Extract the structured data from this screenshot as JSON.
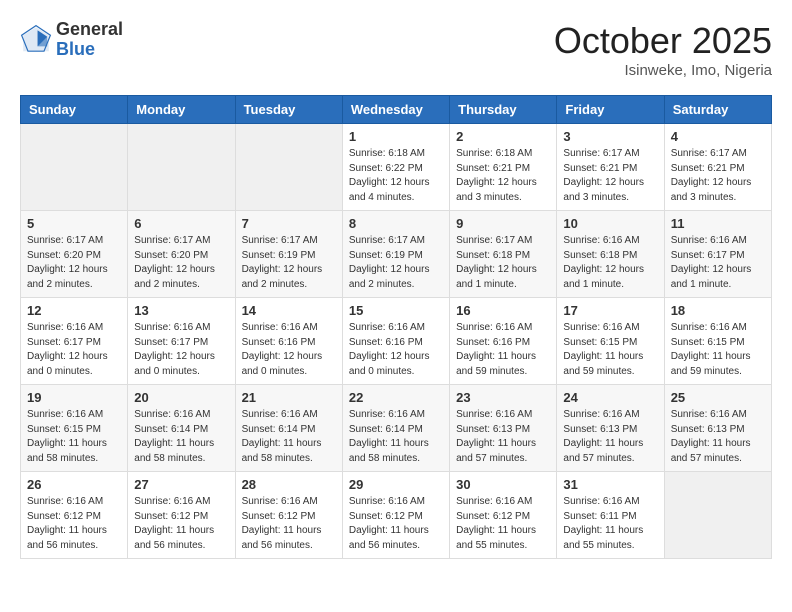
{
  "logo": {
    "general": "General",
    "blue": "Blue"
  },
  "header": {
    "month": "October 2025",
    "location": "Isinweke, Imo, Nigeria"
  },
  "weekdays": [
    "Sunday",
    "Monday",
    "Tuesday",
    "Wednesday",
    "Thursday",
    "Friday",
    "Saturday"
  ],
  "weeks": [
    [
      {
        "day": "",
        "sunrise": "",
        "sunset": "",
        "daylight": ""
      },
      {
        "day": "",
        "sunrise": "",
        "sunset": "",
        "daylight": ""
      },
      {
        "day": "",
        "sunrise": "",
        "sunset": "",
        "daylight": ""
      },
      {
        "day": "1",
        "sunrise": "Sunrise: 6:18 AM",
        "sunset": "Sunset: 6:22 PM",
        "daylight": "Daylight: 12 hours and 4 minutes."
      },
      {
        "day": "2",
        "sunrise": "Sunrise: 6:18 AM",
        "sunset": "Sunset: 6:21 PM",
        "daylight": "Daylight: 12 hours and 3 minutes."
      },
      {
        "day": "3",
        "sunrise": "Sunrise: 6:17 AM",
        "sunset": "Sunset: 6:21 PM",
        "daylight": "Daylight: 12 hours and 3 minutes."
      },
      {
        "day": "4",
        "sunrise": "Sunrise: 6:17 AM",
        "sunset": "Sunset: 6:21 PM",
        "daylight": "Daylight: 12 hours and 3 minutes."
      }
    ],
    [
      {
        "day": "5",
        "sunrise": "Sunrise: 6:17 AM",
        "sunset": "Sunset: 6:20 PM",
        "daylight": "Daylight: 12 hours and 2 minutes."
      },
      {
        "day": "6",
        "sunrise": "Sunrise: 6:17 AM",
        "sunset": "Sunset: 6:20 PM",
        "daylight": "Daylight: 12 hours and 2 minutes."
      },
      {
        "day": "7",
        "sunrise": "Sunrise: 6:17 AM",
        "sunset": "Sunset: 6:19 PM",
        "daylight": "Daylight: 12 hours and 2 minutes."
      },
      {
        "day": "8",
        "sunrise": "Sunrise: 6:17 AM",
        "sunset": "Sunset: 6:19 PM",
        "daylight": "Daylight: 12 hours and 2 minutes."
      },
      {
        "day": "9",
        "sunrise": "Sunrise: 6:17 AM",
        "sunset": "Sunset: 6:18 PM",
        "daylight": "Daylight: 12 hours and 1 minute."
      },
      {
        "day": "10",
        "sunrise": "Sunrise: 6:16 AM",
        "sunset": "Sunset: 6:18 PM",
        "daylight": "Daylight: 12 hours and 1 minute."
      },
      {
        "day": "11",
        "sunrise": "Sunrise: 6:16 AM",
        "sunset": "Sunset: 6:17 PM",
        "daylight": "Daylight: 12 hours and 1 minute."
      }
    ],
    [
      {
        "day": "12",
        "sunrise": "Sunrise: 6:16 AM",
        "sunset": "Sunset: 6:17 PM",
        "daylight": "Daylight: 12 hours and 0 minutes."
      },
      {
        "day": "13",
        "sunrise": "Sunrise: 6:16 AM",
        "sunset": "Sunset: 6:17 PM",
        "daylight": "Daylight: 12 hours and 0 minutes."
      },
      {
        "day": "14",
        "sunrise": "Sunrise: 6:16 AM",
        "sunset": "Sunset: 6:16 PM",
        "daylight": "Daylight: 12 hours and 0 minutes."
      },
      {
        "day": "15",
        "sunrise": "Sunrise: 6:16 AM",
        "sunset": "Sunset: 6:16 PM",
        "daylight": "Daylight: 12 hours and 0 minutes."
      },
      {
        "day": "16",
        "sunrise": "Sunrise: 6:16 AM",
        "sunset": "Sunset: 6:16 PM",
        "daylight": "Daylight: 11 hours and 59 minutes."
      },
      {
        "day": "17",
        "sunrise": "Sunrise: 6:16 AM",
        "sunset": "Sunset: 6:15 PM",
        "daylight": "Daylight: 11 hours and 59 minutes."
      },
      {
        "day": "18",
        "sunrise": "Sunrise: 6:16 AM",
        "sunset": "Sunset: 6:15 PM",
        "daylight": "Daylight: 11 hours and 59 minutes."
      }
    ],
    [
      {
        "day": "19",
        "sunrise": "Sunrise: 6:16 AM",
        "sunset": "Sunset: 6:15 PM",
        "daylight": "Daylight: 11 hours and 58 minutes."
      },
      {
        "day": "20",
        "sunrise": "Sunrise: 6:16 AM",
        "sunset": "Sunset: 6:14 PM",
        "daylight": "Daylight: 11 hours and 58 minutes."
      },
      {
        "day": "21",
        "sunrise": "Sunrise: 6:16 AM",
        "sunset": "Sunset: 6:14 PM",
        "daylight": "Daylight: 11 hours and 58 minutes."
      },
      {
        "day": "22",
        "sunrise": "Sunrise: 6:16 AM",
        "sunset": "Sunset: 6:14 PM",
        "daylight": "Daylight: 11 hours and 58 minutes."
      },
      {
        "day": "23",
        "sunrise": "Sunrise: 6:16 AM",
        "sunset": "Sunset: 6:13 PM",
        "daylight": "Daylight: 11 hours and 57 minutes."
      },
      {
        "day": "24",
        "sunrise": "Sunrise: 6:16 AM",
        "sunset": "Sunset: 6:13 PM",
        "daylight": "Daylight: 11 hours and 57 minutes."
      },
      {
        "day": "25",
        "sunrise": "Sunrise: 6:16 AM",
        "sunset": "Sunset: 6:13 PM",
        "daylight": "Daylight: 11 hours and 57 minutes."
      }
    ],
    [
      {
        "day": "26",
        "sunrise": "Sunrise: 6:16 AM",
        "sunset": "Sunset: 6:12 PM",
        "daylight": "Daylight: 11 hours and 56 minutes."
      },
      {
        "day": "27",
        "sunrise": "Sunrise: 6:16 AM",
        "sunset": "Sunset: 6:12 PM",
        "daylight": "Daylight: 11 hours and 56 minutes."
      },
      {
        "day": "28",
        "sunrise": "Sunrise: 6:16 AM",
        "sunset": "Sunset: 6:12 PM",
        "daylight": "Daylight: 11 hours and 56 minutes."
      },
      {
        "day": "29",
        "sunrise": "Sunrise: 6:16 AM",
        "sunset": "Sunset: 6:12 PM",
        "daylight": "Daylight: 11 hours and 56 minutes."
      },
      {
        "day": "30",
        "sunrise": "Sunrise: 6:16 AM",
        "sunset": "Sunset: 6:12 PM",
        "daylight": "Daylight: 11 hours and 55 minutes."
      },
      {
        "day": "31",
        "sunrise": "Sunrise: 6:16 AM",
        "sunset": "Sunset: 6:11 PM",
        "daylight": "Daylight: 11 hours and 55 minutes."
      },
      {
        "day": "",
        "sunrise": "",
        "sunset": "",
        "daylight": ""
      }
    ]
  ]
}
